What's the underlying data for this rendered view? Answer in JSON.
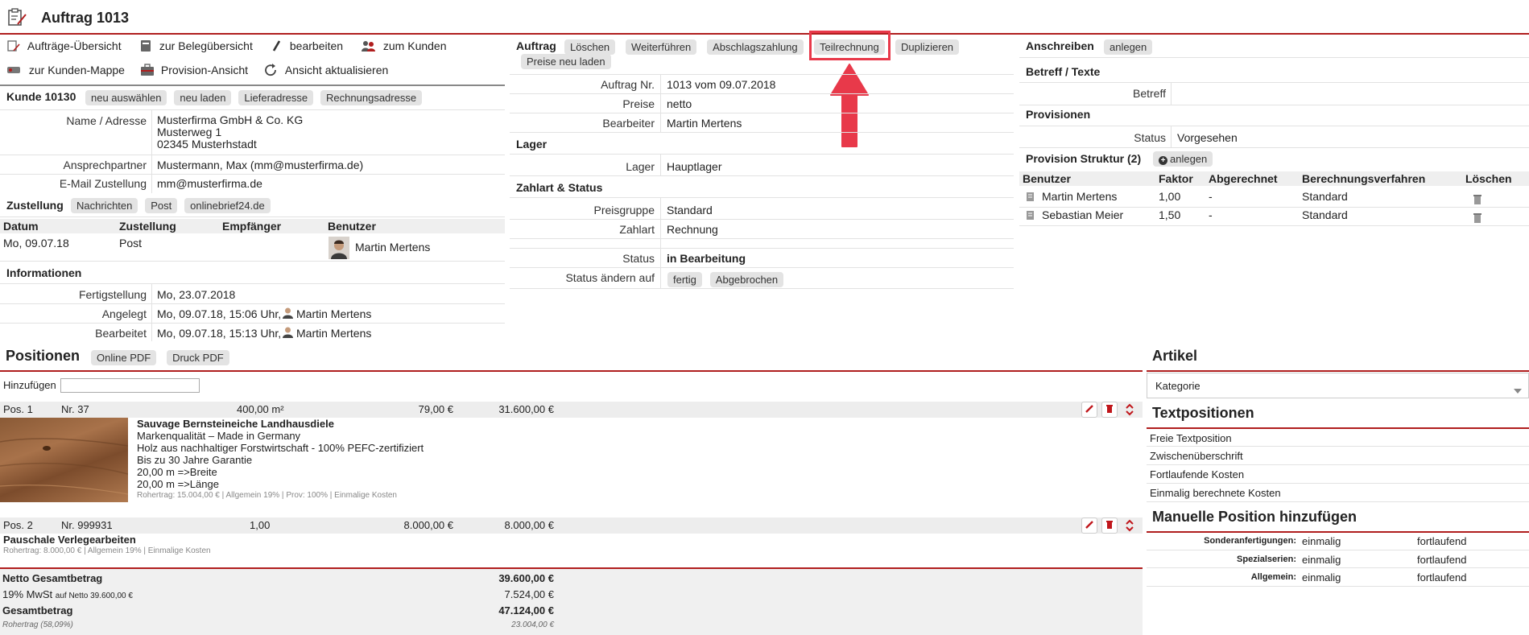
{
  "page": {
    "title": "Auftrag 1013"
  },
  "toolbar": {
    "auftraege_uebersicht": "Aufträge-Übersicht",
    "beleg_uebersicht": "zur Belegübersicht",
    "bearbeiten": "bearbeiten",
    "zum_kunden": "zum Kunden",
    "kunden_mappe": "zur Kunden-Mappe",
    "provision_ansicht": "Provision-Ansicht",
    "ansicht_aktualisieren": "Ansicht aktualisieren"
  },
  "kunde": {
    "title": "Kunde 10130",
    "buttons": [
      "neu auswählen",
      "neu laden",
      "Lieferadresse",
      "Rechnungsadresse"
    ],
    "name_label": "Name / Adresse",
    "name_lines": [
      "Musterfirma GmbH & Co. KG",
      "Musterweg 1",
      "02345 Musterhstadt"
    ],
    "ansprech_label": "Ansprechpartner",
    "ansprech_value": "Mustermann, Max (mm@musterfirma.de)",
    "email_label": "E-Mail Zustellung",
    "email_value": "mm@musterfirma.de"
  },
  "zustellung": {
    "title": "Zustellung",
    "buttons": [
      "Nachrichten",
      "Post",
      "onlinebrief24.de"
    ],
    "columns": [
      "Datum",
      "Zustellung",
      "Empfänger",
      "Benutzer"
    ],
    "row": {
      "datum": "Mo, 09.07.18",
      "zustellung": "Post",
      "empfaenger": "",
      "benutzer": "Martin Mertens"
    }
  },
  "informationen": {
    "title": "Informationen",
    "fertig_label": "Fertigstellung",
    "fertig_value": "Mo, 23.07.2018",
    "angelegt_label": "Angelegt",
    "angelegt_value": "Mo, 09.07.18, 15:06 Uhr,",
    "angelegt_user": "Martin Mertens",
    "bearbeitet_label": "Bearbeitet",
    "bearbeitet_value": "Mo, 09.07.18, 15:13 Uhr,",
    "bearbeitet_user": "Martin Mertens"
  },
  "auftrag": {
    "title": "Auftrag",
    "buttons": [
      "Löschen",
      "Weiterführen",
      "Abschlagszahlung",
      "Teilrechnung",
      "Duplizieren",
      "Preise neu laden"
    ],
    "nr_label": "Auftrag Nr.",
    "nr_value": "1013 vom 09.07.2018",
    "preise_label": "Preise",
    "preise_value": "netto",
    "bearbeiter_label": "Bearbeiter",
    "bearbeiter_value": "Martin Mertens"
  },
  "lager": {
    "title": "Lager",
    "label": "Lager",
    "value": "Hauptlager"
  },
  "zahlart": {
    "title": "Zahlart & Status",
    "preisgruppe_label": "Preisgruppe",
    "preisgruppe_value": "Standard",
    "zahlart_label": "Zahlart",
    "zahlart_value": "Rechnung",
    "status_label": "Status",
    "status_value": "in Bearbeitung",
    "status_aendern_label": "Status ändern auf",
    "status_buttons": [
      "fertig",
      "Abgebrochen"
    ]
  },
  "anschreiben": {
    "title": "Anschreiben",
    "button": "anlegen"
  },
  "betreff": {
    "title": "Betreff / Texte",
    "label": "Betreff"
  },
  "provisionen": {
    "title": "Provisionen",
    "status_label": "Status",
    "status_value": "Vorgesehen",
    "struktur_title": "Provision Struktur (2)",
    "struktur_button": "anlegen",
    "columns": [
      "Benutzer",
      "Faktor",
      "Abgerechnet",
      "Berechnungsverfahren",
      "Löschen"
    ],
    "rows": [
      {
        "benutzer": "Martin Mertens",
        "faktor": "1,00",
        "abgerechnet": "-",
        "verfahren": "Standard"
      },
      {
        "benutzer": "Sebastian Meier",
        "faktor": "1,50",
        "abgerechnet": "-",
        "verfahren": "Standard"
      }
    ]
  },
  "positionen": {
    "title": "Positionen",
    "buttons": [
      "Online PDF",
      "Druck PDF"
    ],
    "add_label": "Hinzufügen",
    "add_value": "",
    "items": [
      {
        "pos": "Pos. 1",
        "nr": "Nr. 37",
        "menge": "400,00 m²",
        "einzel": "79,00 €",
        "gesamt": "31.600,00 €",
        "name": "Sauvage Bernsteineiche Landhausdiele",
        "lines": [
          "Markenqualität – Made in Germany",
          "Holz aus nachhaltiger Forstwirtschaft - 100% PEFC-zertifiziert",
          "Bis zu 30 Jahre Garantie",
          "20,00 m =>Breite",
          "20,00 m =>Länge"
        ],
        "meta": "Rohertrag: 15.004,00 € | Allgemein 19% | Prov: 100% | Einmalige Kosten"
      },
      {
        "pos": "Pos. 2",
        "nr": "Nr. 999931",
        "menge": "1,00",
        "einzel": "8.000,00 €",
        "gesamt": "8.000,00 €",
        "name": "Pauschale Verlegearbeiten",
        "lines": [],
        "meta": "Rohertrag: 8.000,00 € | Allgemein 19% | Einmalige Kosten"
      }
    ],
    "summary": {
      "netto_label": "Netto Gesamtbetrag",
      "netto_value": "39.600,00 €",
      "mwst_label": "19% MwSt",
      "mwst_sub": "auf Netto 39.600,00 €",
      "mwst_value": "7.524,00 €",
      "gesamt_label": "Gesamtbetrag",
      "gesamt_value": "47.124,00 €",
      "rohertrag_label": "Rohertrag (58,09%)",
      "rohertrag_value": "23.004,00 €"
    }
  },
  "artikel": {
    "title": "Artikel",
    "select_value": "Kategorie"
  },
  "textpositionen": {
    "title": "Textpositionen",
    "items": [
      "Freie Textposition",
      "Zwischenüberschrift",
      "Fortlaufende Kosten",
      "Einmalig berechnete Kosten"
    ]
  },
  "manuelle": {
    "title": "Manuelle Position hinzufügen",
    "rows": [
      {
        "label": "Sonderanfertigungen:",
        "a": "einmalig",
        "b": "fortlaufend"
      },
      {
        "label": "Spezialserien:",
        "a": "einmalig",
        "b": "fortlaufend"
      },
      {
        "label": "Allgemein:",
        "a": "einmalig",
        "b": "fortlaufend"
      }
    ]
  },
  "colors": {
    "accent": "#b01e1e",
    "highlight": "#e8394a",
    "chip": "#e3e3e3"
  }
}
